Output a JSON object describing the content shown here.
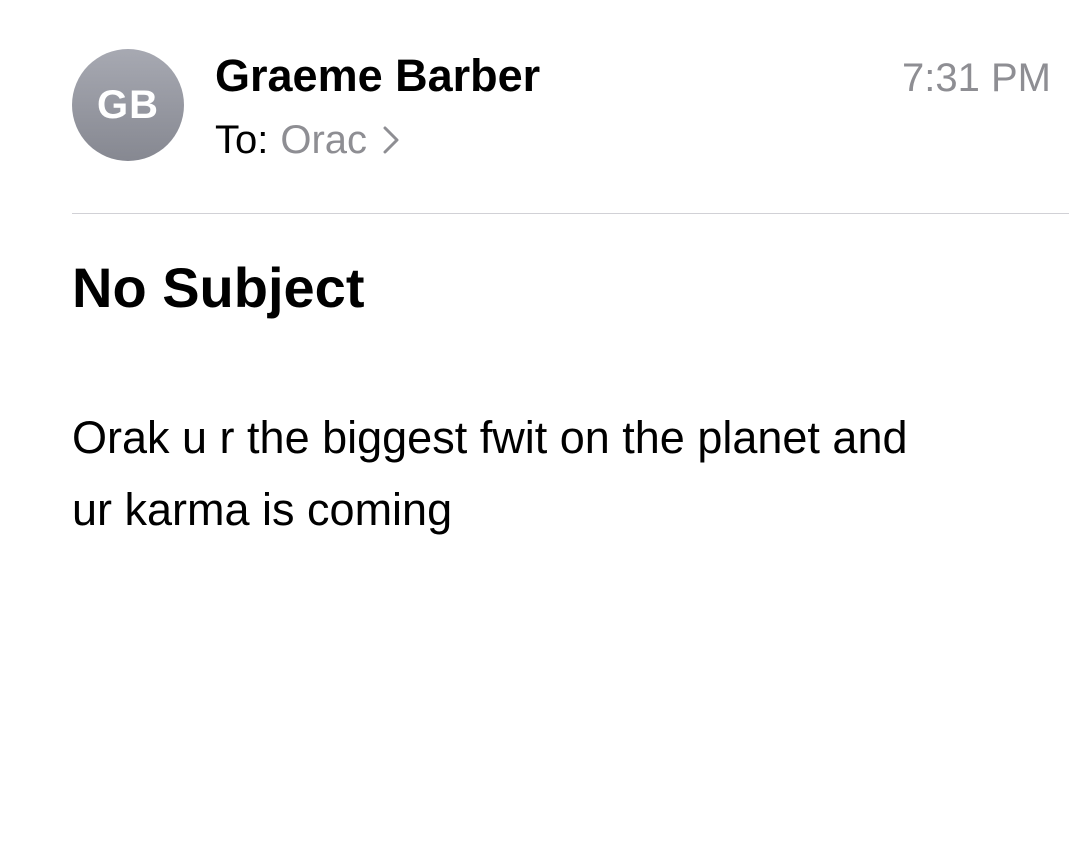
{
  "email": {
    "sender": {
      "initials": "GB",
      "name": "Graeme Barber"
    },
    "time": "7:31 PM",
    "recipient": {
      "label": "To:",
      "name": "Orac"
    },
    "subject": "No Subject",
    "body_lines": [
      "Orak u r the biggest fwit on the planet and",
      "ur karma is coming"
    ]
  },
  "colors": {
    "avatar_gradient_top": "#a7a9b2",
    "avatar_gradient_bottom": "#868891",
    "secondary_text": "#8e8e93",
    "divider": "#d1d1d6"
  },
  "icons": {
    "recipient_chevron": "chevron-right-icon"
  }
}
